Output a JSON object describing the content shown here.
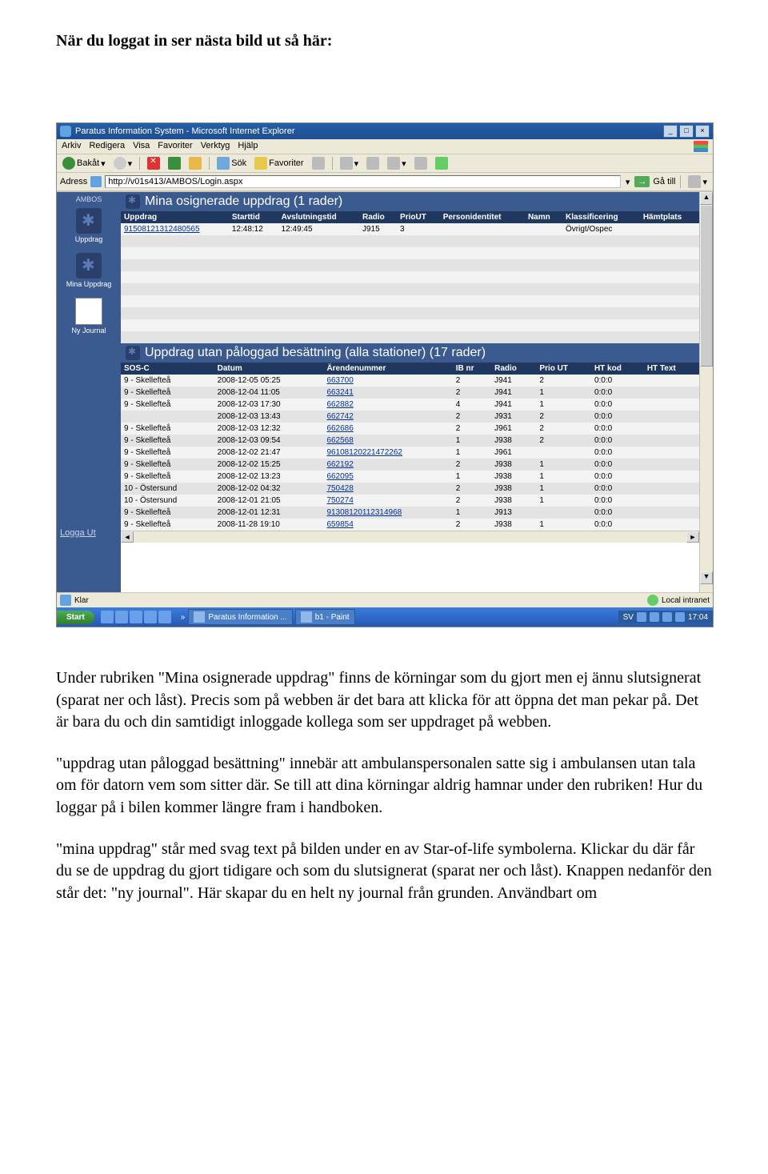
{
  "intro": "När du loggat in ser nästa bild ut så här:",
  "browser": {
    "title": "Paratus Information System - Microsoft Internet Explorer",
    "menus": [
      "Arkiv",
      "Redigera",
      "Visa",
      "Favoriter",
      "Verktyg",
      "Hjälp"
    ],
    "toolbar": {
      "back": "Bakåt",
      "search": "Sök",
      "favorites": "Favoriter"
    },
    "address_label": "Adress",
    "address": "http://v01s413/AMBOS/Login.aspx",
    "go_label": "Gå till",
    "status_left": "Klar",
    "status_right": "Local intranet"
  },
  "sidebar": {
    "brand": "AMBOS",
    "items": [
      {
        "label": "Uppdrag"
      },
      {
        "label": "Mina Uppdrag"
      },
      {
        "label": "Ny Journal"
      }
    ],
    "logout": "Logga Ut"
  },
  "section1": {
    "title": "Mina osignerade uppdrag (1 rader)",
    "headers": [
      "Uppdrag",
      "Starttid",
      "Avslutningstid",
      "Radio",
      "PrioUT",
      "Personidentitet",
      "Namn",
      "Klassificering",
      "Hämtplats"
    ],
    "rows": [
      {
        "uppdrag": "91508121312480565",
        "start": "12:48:12",
        "slut": "12:49:45",
        "radio": "J915",
        "prio": "3",
        "person": "",
        "namn": "",
        "klass": "Övrigt/Ospec",
        "hamt": ""
      }
    ]
  },
  "section2": {
    "title": "Uppdrag utan påloggad besättning (alla stationer) (17 rader)",
    "headers": [
      "SOS-C",
      "Datum",
      "Ärendenummer",
      "IB nr",
      "Radio",
      "Prio UT",
      "HT kod",
      "HT Text"
    ],
    "rows": [
      {
        "sos": "9 - Skellefteå",
        "datum": "2008-12-05 05:25",
        "nr": "663700",
        "ib": "2",
        "radio": "J941",
        "prio": "2",
        "htk": "0:0:0",
        "htt": ""
      },
      {
        "sos": "9 - Skellefteå",
        "datum": "2008-12-04 11:05",
        "nr": "663241",
        "ib": "2",
        "radio": "J941",
        "prio": "1",
        "htk": "0:0:0",
        "htt": ""
      },
      {
        "sos": "9 - Skellefteå",
        "datum": "2008-12-03 17:30",
        "nr": "662882",
        "ib": "4",
        "radio": "J941",
        "prio": "1",
        "htk": "0:0:0",
        "htt": ""
      },
      {
        "sos": "",
        "datum": "2008-12-03 13:43",
        "nr": "662742",
        "ib": "2",
        "radio": "J931",
        "prio": "2",
        "htk": "0:0:0",
        "htt": ""
      },
      {
        "sos": "9 - Skellefteå",
        "datum": "2008-12-03 12:32",
        "nr": "662686",
        "ib": "2",
        "radio": "J961",
        "prio": "2",
        "htk": "0:0:0",
        "htt": ""
      },
      {
        "sos": "9 - Skellefteå",
        "datum": "2008-12-03 09:54",
        "nr": "662568",
        "ib": "1",
        "radio": "J938",
        "prio": "2",
        "htk": "0:0:0",
        "htt": ""
      },
      {
        "sos": "9 - Skellefteå",
        "datum": "2008-12-02 21:47",
        "nr": "96108120221472262",
        "ib": "1",
        "radio": "J961",
        "prio": "",
        "htk": "0:0:0",
        "htt": ""
      },
      {
        "sos": "9 - Skellefteå",
        "datum": "2008-12-02 15:25",
        "nr": "662192",
        "ib": "2",
        "radio": "J938",
        "prio": "1",
        "htk": "0:0:0",
        "htt": ""
      },
      {
        "sos": "9 - Skellefteå",
        "datum": "2008-12-02 13:23",
        "nr": "662095",
        "ib": "1",
        "radio": "J938",
        "prio": "1",
        "htk": "0:0:0",
        "htt": ""
      },
      {
        "sos": "10 - Östersund",
        "datum": "2008-12-02 04:32",
        "nr": "750428",
        "ib": "2",
        "radio": "J938",
        "prio": "1",
        "htk": "0:0:0",
        "htt": ""
      },
      {
        "sos": "10 - Östersund",
        "datum": "2008-12-01 21:05",
        "nr": "750274",
        "ib": "2",
        "radio": "J938",
        "prio": "1",
        "htk": "0:0:0",
        "htt": ""
      },
      {
        "sos": "9 - Skellefteå",
        "datum": "2008-12-01 12:31",
        "nr": "91308120112314968",
        "ib": "1",
        "radio": "J913",
        "prio": "",
        "htk": "0:0:0",
        "htt": ""
      },
      {
        "sos": "9 - Skellefteå",
        "datum": "2008-11-28 19:10",
        "nr": "659854",
        "ib": "2",
        "radio": "J938",
        "prio": "1",
        "htk": "0:0:0",
        "htt": ""
      }
    ]
  },
  "taskbar": {
    "start": "Start",
    "tasks": [
      {
        "label": "Paratus Information ..."
      },
      {
        "label": "b1 - Paint"
      }
    ],
    "time": "17:04",
    "lang": "SV"
  },
  "paragraphs": {
    "p1": "Under rubriken \"Mina osignerade uppdrag\" finns de körningar som du gjort men ej ännu slutsignerat (sparat ner och låst). Precis som på webben är det bara att klicka för att öppna det man pekar på. Det är bara du och din samtidigt inloggade kollega som ser uppdraget på webben.",
    "p2": "\"uppdrag utan påloggad besättning\" innebär att ambulanspersonalen satte sig i ambulansen utan tala om för datorn vem som sitter där. Se till att dina körningar aldrig hamnar under den rubriken! Hur du loggar på i bilen kommer längre fram i handboken.",
    "p3": "\"mina uppdrag\" står med svag text på bilden under en av Star-of-life symbolerna. Klickar du där får du se de uppdrag du gjort tidigare och som du slutsignerat (sparat ner och låst). Knappen nedanför den står det: \"ny journal\". Här skapar du en helt ny journal från grunden. Användbart om"
  }
}
